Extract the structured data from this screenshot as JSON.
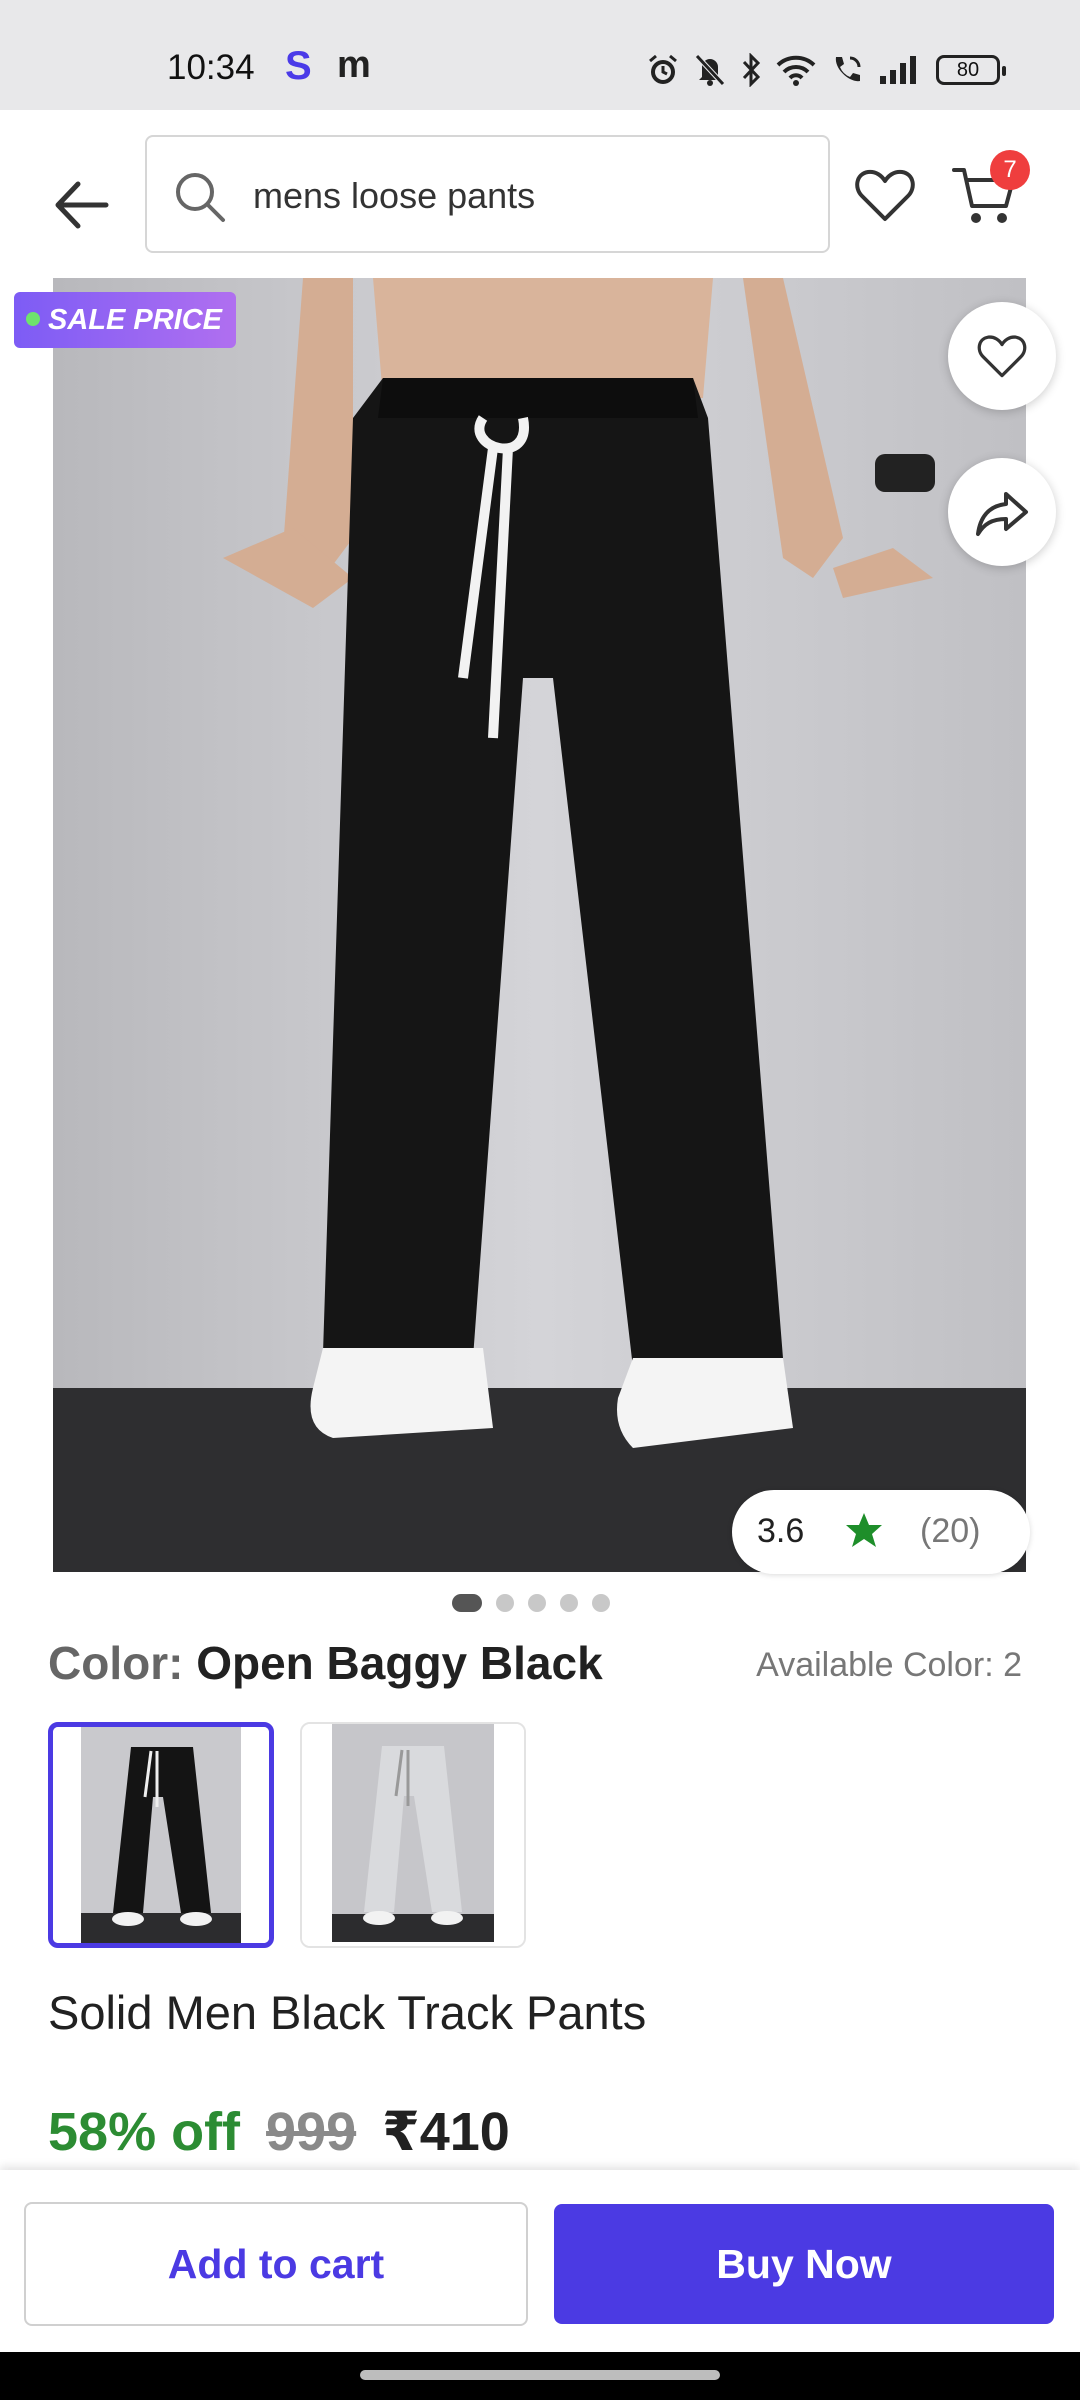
{
  "status_bar": {
    "time": "10:34",
    "app_icon_1": "S",
    "app_icon_2": "m",
    "battery": "80",
    "icons": [
      "alarm-icon",
      "mute-icon",
      "bluetooth-icon",
      "wifi-icon",
      "call-icon",
      "signal-icon",
      "battery-icon"
    ]
  },
  "header": {
    "search_text": "mens loose pants",
    "cart_count": "7"
  },
  "product": {
    "sale_badge": "SALE PRICE",
    "rating": "3.6",
    "rating_count": "(20)",
    "image_count": 5,
    "active_image": 0,
    "color_label": "Color:",
    "color_name": "Open Baggy Black",
    "available_colors": "Available Color: 2",
    "swatches": [
      "black",
      "light-grey"
    ],
    "title": "Solid Men Black Track Pants",
    "discount": "58% off",
    "mrp": "999",
    "price": "₹410"
  },
  "actions": {
    "add_to_cart": "Add to cart",
    "buy_now": "Buy Now"
  },
  "colors": {
    "accent": "#4b3ae3",
    "discount_green": "#2c8c33",
    "star_green": "#1e8e2a",
    "badge_red": "#ef3e3e"
  }
}
